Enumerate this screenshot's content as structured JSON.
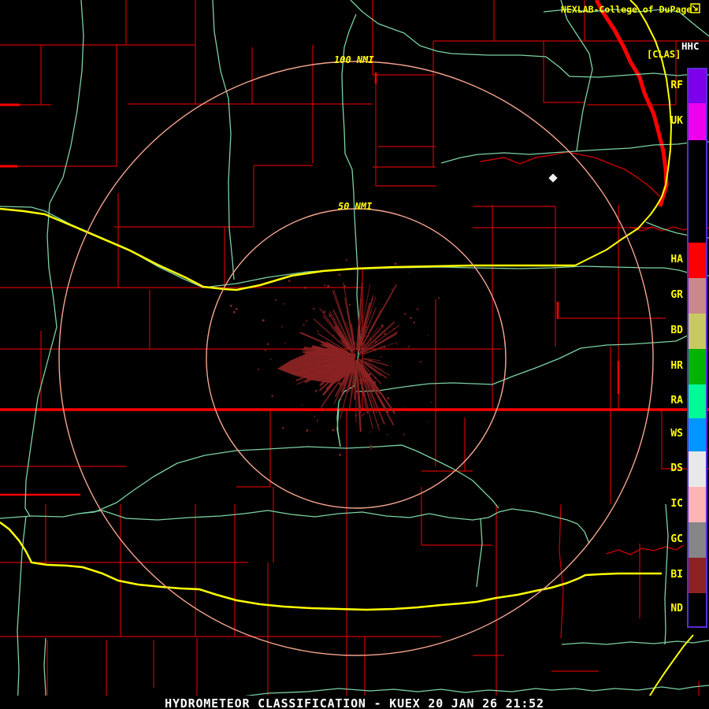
{
  "product": {
    "source": "NEXLAB-College of DuPage",
    "logo_icon": "pointer-box-icon",
    "name": "HHC",
    "classification_tag": "[CLAS]",
    "title_bar": "HYDROMETEOR CLASSIFICATION - KUEX 20 JAN 26 21:52",
    "station": "KUEX",
    "datetime": "20 JAN 26 21:52"
  },
  "range_rings": {
    "outer": "100 NMI",
    "inner": "50 NMI"
  },
  "legend": {
    "items": [
      {
        "label": "RF",
        "color": "#7d00eb"
      },
      {
        "label": "UK",
        "color": "#ee00ee"
      },
      {
        "label": "HA",
        "color": "#ff0000"
      },
      {
        "label": "GR",
        "color": "#c98989"
      },
      {
        "label": "BD",
        "color": "#c9c964"
      },
      {
        "label": "HR",
        "color": "#00b400"
      },
      {
        "label": "RA",
        "color": "#00fa96"
      },
      {
        "label": "WS",
        "color": "#0096ff"
      },
      {
        "label": "DS",
        "color": "#e8e8e8"
      },
      {
        "label": "IC",
        "color": "#ffb4b4"
      },
      {
        "label": "GC",
        "color": "#868686"
      },
      {
        "label": "BI",
        "color": "#8b2323"
      },
      {
        "label": "ND",
        "color": "#000000"
      }
    ]
  },
  "colors": {
    "background": "#000000",
    "county_line": "#cc0000",
    "state_line": "#ff0000",
    "river": "#7cd2a2",
    "highway": "#ffff00",
    "range_ring": "#f5a48e",
    "echo": "#8b2323",
    "text_yellow": "#ffff00",
    "text_white": "#ffffff",
    "legend_border": "#5a2bd8"
  }
}
